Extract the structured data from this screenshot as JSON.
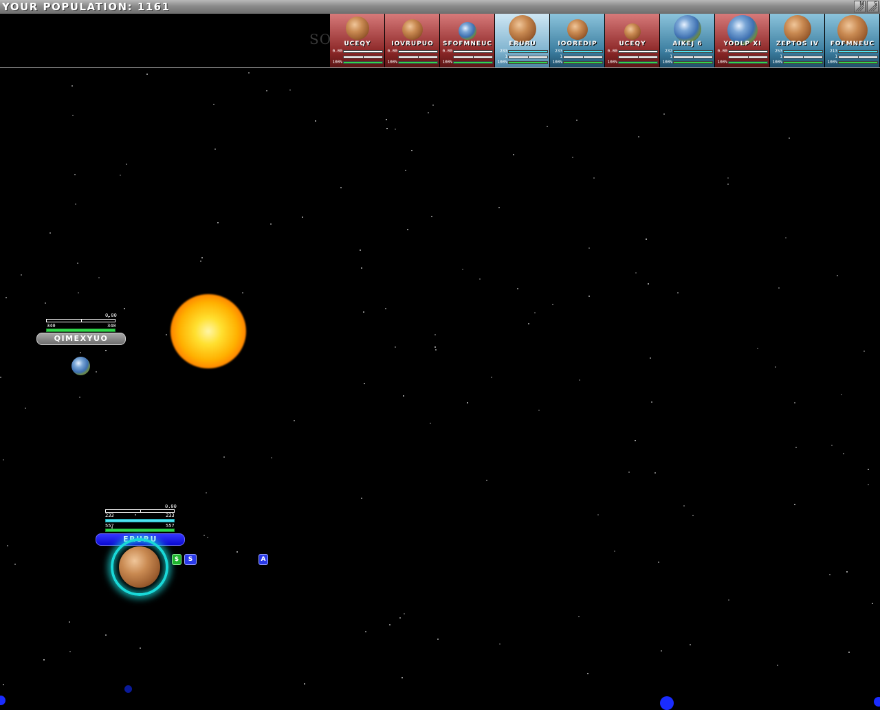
{
  "topbar": {
    "population_label": "YOUR POPULATION:",
    "population_value": "1161",
    "buttons": [
      "M",
      "S"
    ]
  },
  "watermark": {
    "text": "SOFTPEDIA"
  },
  "planet_cards": [
    {
      "name": "UCEQY",
      "owner": "enemy",
      "kind": "mars",
      "num_top": "0.00",
      "num_mid": "",
      "num_bottom": "100%",
      "fill_top": 0.0,
      "fill_mid": 0.5,
      "fill_bottom": 1.0
    },
    {
      "name": "IOVRUPUO",
      "owner": "enemy",
      "kind": "mars",
      "num_top": "0.00",
      "num_mid": "",
      "num_bottom": "100%",
      "fill_top": 0.0,
      "fill_mid": 0.5,
      "fill_bottom": 1.0
    },
    {
      "name": "SFOFMNEUC",
      "owner": "enemy",
      "kind": "earth",
      "num_top": "0.00",
      "num_mid": "",
      "num_bottom": "100%",
      "fill_top": 0.0,
      "fill_mid": 0.5,
      "fill_bottom": 1.0
    },
    {
      "name": "ERURU",
      "owner": "selected",
      "kind": "mars",
      "num_top": "233",
      "num_mid": "1",
      "num_bottom": "100%",
      "fill_top": 1.0,
      "fill_mid": 0.5,
      "fill_bottom": 1.0
    },
    {
      "name": "IOOREDIP",
      "owner": "own",
      "kind": "mars",
      "num_top": "233",
      "num_mid": "1",
      "num_bottom": "100%",
      "fill_top": 1.0,
      "fill_mid": 0.5,
      "fill_bottom": 1.0
    },
    {
      "name": "UCEQY",
      "owner": "enemy",
      "kind": "mars",
      "num_top": "0.00",
      "num_mid": "",
      "num_bottom": "100%",
      "fill_top": 0.0,
      "fill_mid": 0.5,
      "fill_bottom": 1.0
    },
    {
      "name": "AIKEJ 6",
      "owner": "own",
      "kind": "earth",
      "num_top": "232",
      "num_mid": "1",
      "num_bottom": "100%",
      "fill_top": 1.0,
      "fill_mid": 0.5,
      "fill_bottom": 1.0
    },
    {
      "name": "YODLP XI",
      "owner": "enemy",
      "kind": "earth",
      "num_top": "0.00",
      "num_mid": "",
      "num_bottom": "100%",
      "fill_top": 0.0,
      "fill_mid": 0.5,
      "fill_bottom": 1.0
    },
    {
      "name": "ZEPTOS IV",
      "owner": "own",
      "kind": "mars",
      "num_top": "253",
      "num_mid": "1",
      "num_bottom": "100%",
      "fill_top": 1.0,
      "fill_mid": 0.5,
      "fill_bottom": 1.0
    },
    {
      "name": "FOFMNEUC",
      "owner": "own",
      "kind": "mars",
      "num_top": "213",
      "num_mid": "1",
      "num_bottom": "100%",
      "fill_top": 1.0,
      "fill_mid": 0.5,
      "fill_bottom": 1.0
    }
  ],
  "world": {
    "qimexyuo": {
      "name": "QIMEXYUO",
      "value_top": "0.00",
      "value_left": "340",
      "value_right": "340",
      "shield_fill": 1.0
    },
    "eruru": {
      "name": "ERURU",
      "value_top": "0.00",
      "pop_left": "233",
      "pop_right": "233",
      "def_left": "557",
      "def_right": "557",
      "pop_fill": 1.0,
      "def_fill": 1.0,
      "icons": [
        {
          "name": "money-icon",
          "glyph": "$"
        },
        {
          "name": "build-icon",
          "glyph": "S"
        },
        {
          "name": "ship-icon",
          "glyph": "A"
        }
      ]
    }
  },
  "colors": {
    "own_accent": "#1212e8",
    "enemy_accent": "#808080",
    "pop_bar": "#4fe3f0",
    "defense_bar": "#2fd84a",
    "selection_ring": "#19d8d8"
  }
}
